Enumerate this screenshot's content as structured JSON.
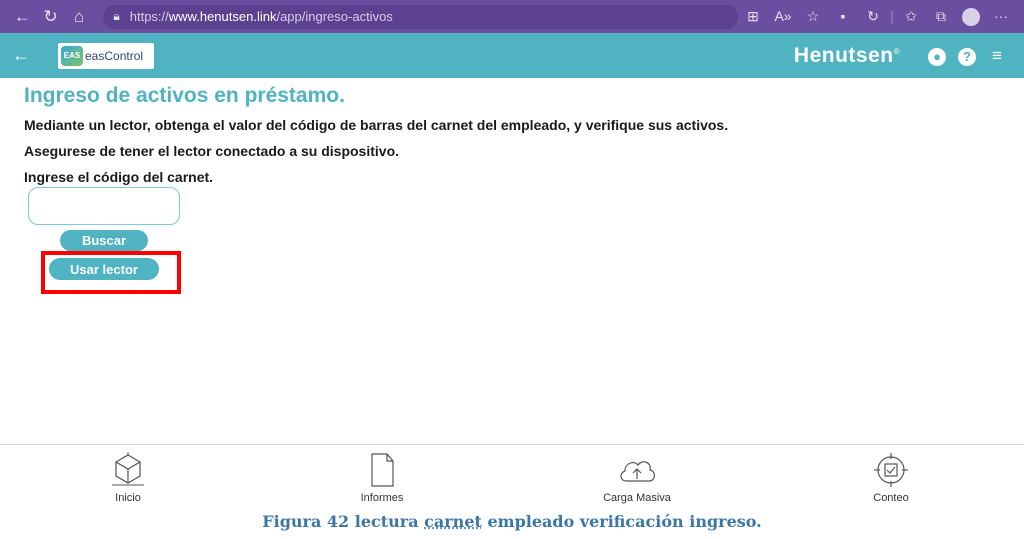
{
  "browser": {
    "url_prefix": "https://",
    "url_domain": "www.henutsen.link",
    "url_path": "/app/ingreso-activos",
    "icons": [
      "back-icon",
      "refresh-icon",
      "home-icon",
      "lock-icon",
      "app-grid-icon",
      "read-aloud-icon",
      "favorite-icon",
      "extension-icon",
      "refresh-sync-icon",
      "favorites-icon",
      "collections-icon",
      "profile-icon",
      "more-icon"
    ]
  },
  "header": {
    "logo_mark": "EAS",
    "logo_text": "easControl",
    "brand": "Henutsen",
    "brand_mark": "®"
  },
  "main": {
    "title": "Ingreso de activos en préstamo.",
    "instruction_1": "Mediante un lector, obtenga el valor del código de barras del carnet del empleado, y verifique sus activos.",
    "instruction_2": "Asegurese de tener el lector conectado a su dispositivo.",
    "instruction_3": "Ingrese el código del carnet.",
    "code_input_value": "",
    "search_button": "Buscar",
    "reader_button": "Usar lector"
  },
  "bottom_nav": [
    {
      "label": "Inicio",
      "icon": "cube-home-icon"
    },
    {
      "label": "Informes",
      "icon": "document-icon"
    },
    {
      "label": "Carga Masiva",
      "icon": "cloud-upload-icon"
    },
    {
      "label": "Conteo",
      "icon": "target-check-icon"
    }
  ],
  "caption": {
    "before": "Figura 42 lectura ",
    "underlined": "carnet",
    "after": " empleado verificación ingreso."
  },
  "colors": {
    "accent": "#4fb3c2",
    "browser_bar": "#6a4fa0",
    "highlight": "#ff0000",
    "caption": "#3b76a8"
  }
}
